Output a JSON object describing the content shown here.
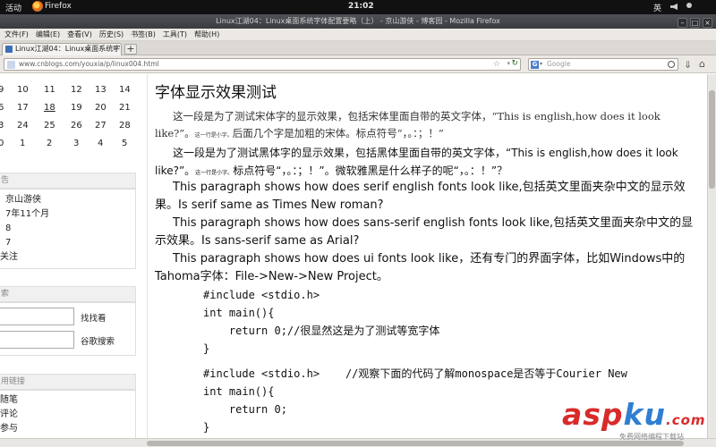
{
  "panel": {
    "activities": "活动",
    "app_name": "Firefox",
    "clock": "21:02",
    "lang": "英"
  },
  "window": {
    "title": "Linux江湖04：Linux桌面系统字体配置要略（上） - 京山游侠 - 博客园 - Mozilla Firefox",
    "controls": [
      "–",
      "□",
      "×"
    ]
  },
  "menu": {
    "items": [
      "文件(F)",
      "编辑(E)",
      "查看(V)",
      "历史(S)",
      "书签(B)",
      "工具(T)",
      "帮助(H)"
    ]
  },
  "tabs": {
    "active_title": "Linux江湖04：Linux桌面系统字...",
    "close": "×",
    "new_tab": "+"
  },
  "nav": {
    "url": "www.cnblogs.com/youxia/p/linux004.html",
    "search_placeholder": "Google",
    "search_engine": "G"
  },
  "sidebar": {
    "calendar_rows": [
      [
        "9",
        "10",
        "11",
        "12",
        "13",
        "14"
      ],
      [
        "6",
        "17",
        "18",
        "19",
        "20",
        "21"
      ],
      [
        "3",
        "24",
        "25",
        "26",
        "27",
        "28"
      ],
      [
        "0",
        "1",
        "2",
        "3",
        "4",
        "5"
      ]
    ],
    "notice_header": "告",
    "notice_lines": [
      "京山游侠",
      "7年11个月",
      "8",
      "7",
      "关注"
    ],
    "search_header": "索",
    "search_button": "找找看",
    "google_button": "谷歌搜索",
    "links_header": "用链接",
    "links": [
      "随笔",
      "评论",
      "参与"
    ]
  },
  "article": {
    "title": "字体显示效果测试",
    "p1_main": "这一段是为了测试宋体字的显示效果，包括宋体里面自带的英文字体，“This is english,how does it look like?”。",
    "p1_small": "这一行是小字。",
    "p1_tail": "后面几个字是加粗的宋体。标点符号“，。：；！”",
    "p2_main": "这一段是为了测试黑体字的显示效果，包括黑体里面自带的英文字体，“This is english,how does it look like?”。",
    "p2_small": "这一行是小字。",
    "p2_tail": "标点符号“，。：；！”。微软雅黑是什么样子的呢“，。：！”？",
    "p3": "This paragraph shows how does serif english fonts look like,包括英文里面夹杂中文的显示效果。Is serif same as Times New roman?",
    "p4": "This paragraph shows how does sans-serif english fonts look like,包括英文里面夹杂中文的显示效果。Is sans-serif same as Arial?",
    "p5": "This paragraph shows how does ui fonts look like，还有专门的界面字体，比如Windows中的Tahoma字体：File->New->New Project。",
    "code1": [
      "#include <stdio.h>",
      "int main(){",
      "    return 0;//很显然这是为了测试等宽字体",
      "}"
    ],
    "code2": [
      "#include <stdio.h>    //观察下面的代码了解monospace是否等于Courier New",
      "int main(){",
      "    return 0;",
      "}"
    ]
  },
  "watermark": {
    "brand_asp": "asp",
    "brand_ku": "ku",
    "brand_com": ".com",
    "tagline": "免费网络编程下载站"
  }
}
